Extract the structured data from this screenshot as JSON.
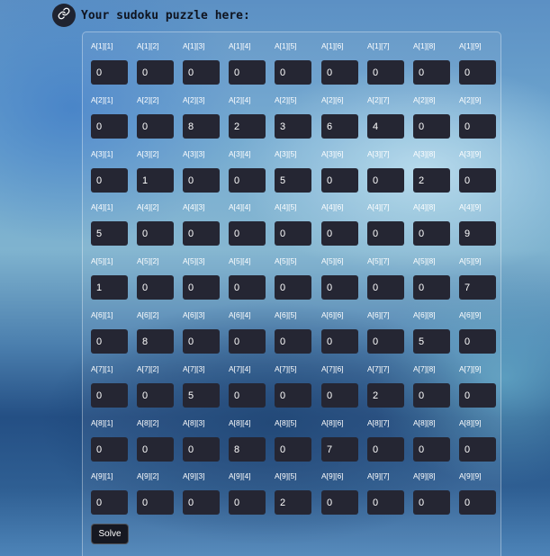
{
  "header": {
    "title": "Your sudoku puzzle here:",
    "icon": "link-icon"
  },
  "grid": {
    "rows": [
      [
        0,
        0,
        0,
        0,
        0,
        0,
        0,
        0,
        0
      ],
      [
        0,
        0,
        8,
        2,
        3,
        6,
        4,
        0,
        0
      ],
      [
        0,
        1,
        0,
        0,
        5,
        0,
        0,
        2,
        0
      ],
      [
        5,
        0,
        0,
        0,
        0,
        0,
        0,
        0,
        9
      ],
      [
        1,
        0,
        0,
        0,
        0,
        0,
        0,
        0,
        7
      ],
      [
        0,
        8,
        0,
        0,
        0,
        0,
        0,
        5,
        0
      ],
      [
        0,
        0,
        5,
        0,
        0,
        0,
        2,
        0,
        0
      ],
      [
        0,
        0,
        0,
        8,
        0,
        7,
        0,
        0,
        0
      ],
      [
        0,
        0,
        0,
        0,
        2,
        0,
        0,
        0,
        0
      ]
    ]
  },
  "actions": {
    "solve_label": "Solve"
  }
}
